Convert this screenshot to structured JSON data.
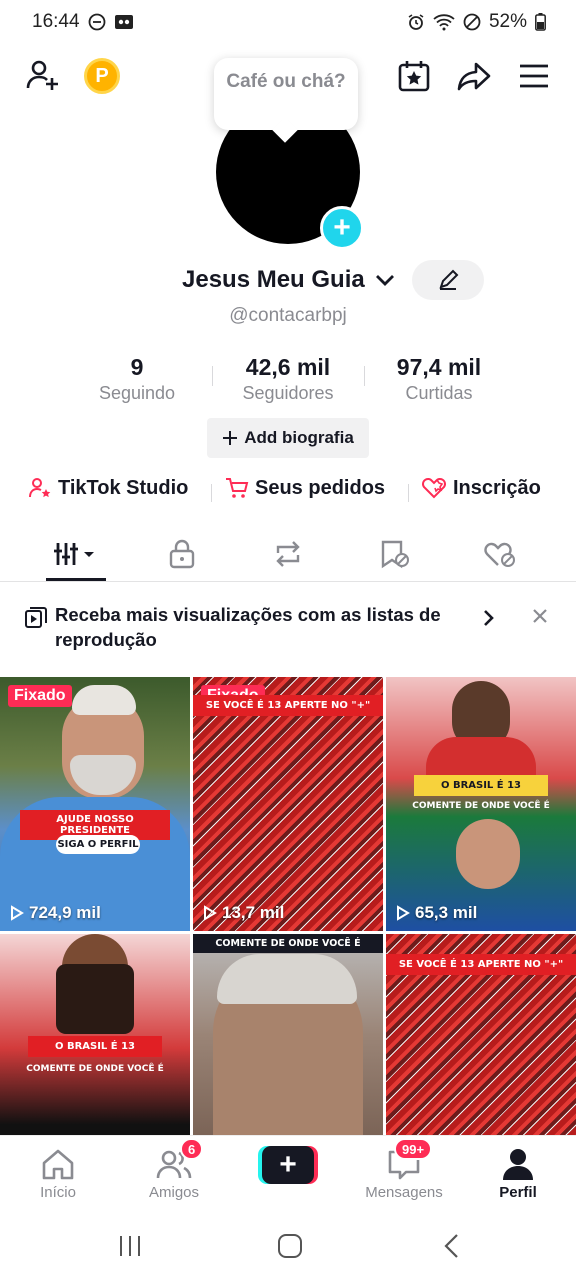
{
  "status_bar": {
    "time": "16:44",
    "battery": "52%"
  },
  "bubble": {
    "text": "Café ou chá?"
  },
  "profile": {
    "name": "Jesus Meu Guia",
    "handle": "@contacarbpj",
    "bio_button": "Add biografia"
  },
  "stats": [
    {
      "value": "9",
      "label": "Seguindo"
    },
    {
      "value": "42,6 mil",
      "label": "Seguidores"
    },
    {
      "value": "97,4 mil",
      "label": "Curtidas"
    }
  ],
  "links": [
    {
      "label": "TikTok Studio",
      "icon": "person-star-icon"
    },
    {
      "label": "Seus pedidos",
      "icon": "cart-icon"
    },
    {
      "label": "Inscrição",
      "icon": "heart-subscription-icon"
    }
  ],
  "promo": {
    "text": "Receba mais visualizações com as listas de reprodução"
  },
  "videos": [
    {
      "pinned": "Fixado",
      "views": "724,9 mil",
      "overlay1": "AJUDE NOSSO PRESIDENTE",
      "overlay2": "SIGA O PERFIL"
    },
    {
      "pinned": "Fixado",
      "views": "13,7 mil",
      "overlay1": "SE VOCÊ É 13 APERTE NO \"+\""
    },
    {
      "views": "65,3 mil",
      "overlay1": "O BRASIL É 13",
      "overlay2": "COMENTE DE ONDE VOCÊ É"
    },
    {
      "overlay1": "O BRASIL É 13",
      "overlay2": "COMENTE DE ONDE VOCÊ É"
    },
    {
      "overlay1": "COMENTE DE ONDE VOCÊ É"
    },
    {
      "overlay1": "SE VOCÊ É 13 APERTE NO \"+\""
    }
  ],
  "bottom_nav": {
    "home": "Início",
    "friends": "Amigos",
    "friends_badge": "6",
    "messages": "Mensagens",
    "messages_badge": "99+",
    "profile": "Perfil"
  },
  "colors": {
    "accent": "#fe2c55",
    "cyan": "#25f4ee",
    "text": "#161823",
    "muted": "#8a8b91"
  }
}
